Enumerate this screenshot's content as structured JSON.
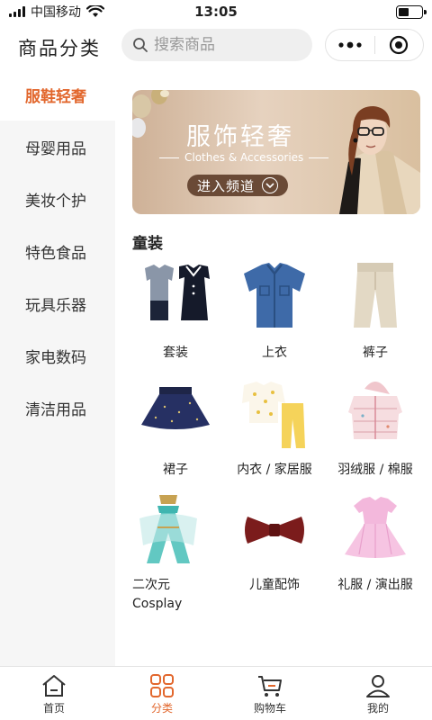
{
  "status_bar": {
    "carrier": "中国移动",
    "time": "13:05"
  },
  "header": {
    "title": "商品分类",
    "search_placeholder": "搜索商品"
  },
  "sidebar": {
    "items": [
      {
        "label": "服鞋轻奢",
        "active": true
      },
      {
        "label": "母婴用品",
        "active": false
      },
      {
        "label": "美妆个护",
        "active": false
      },
      {
        "label": "特色食品",
        "active": false
      },
      {
        "label": "玩具乐器",
        "active": false
      },
      {
        "label": "家电数码",
        "active": false
      },
      {
        "label": "清洁用品",
        "active": false
      }
    ]
  },
  "banner": {
    "title": "服饰轻奢",
    "subtitle": "Clothes & Accessories",
    "button_label": "进入频道"
  },
  "section": {
    "title": "童装",
    "items": [
      {
        "label": "套装",
        "icon": "outfit-set-icon"
      },
      {
        "label": "上衣",
        "icon": "shirt-icon"
      },
      {
        "label": "裤子",
        "icon": "pants-icon"
      },
      {
        "label": "裙子",
        "icon": "skirt-icon"
      },
      {
        "label": "内衣 / 家居服",
        "icon": "pajamas-icon"
      },
      {
        "label": "羽绒服 / 棉服",
        "icon": "down-jacket-icon"
      },
      {
        "label_line1": "二次元",
        "label_line2": "Cosplay",
        "icon": "cosplay-costume-icon"
      },
      {
        "label": "儿童配饰",
        "icon": "bow-tie-icon"
      },
      {
        "label": "礼服 / 演出服",
        "icon": "dress-icon"
      }
    ]
  },
  "tabbar": {
    "items": [
      {
        "label": "首页",
        "icon": "home-icon",
        "active": false
      },
      {
        "label": "分类",
        "icon": "category-grid-icon",
        "active": true
      },
      {
        "label": "购物车",
        "icon": "cart-icon",
        "active": false
      },
      {
        "label": "我的",
        "icon": "user-icon",
        "active": false
      }
    ]
  },
  "colors": {
    "accent": "#e2672d",
    "sidebar_bg": "#f6f6f6",
    "banner_button": "#6a4a36"
  }
}
